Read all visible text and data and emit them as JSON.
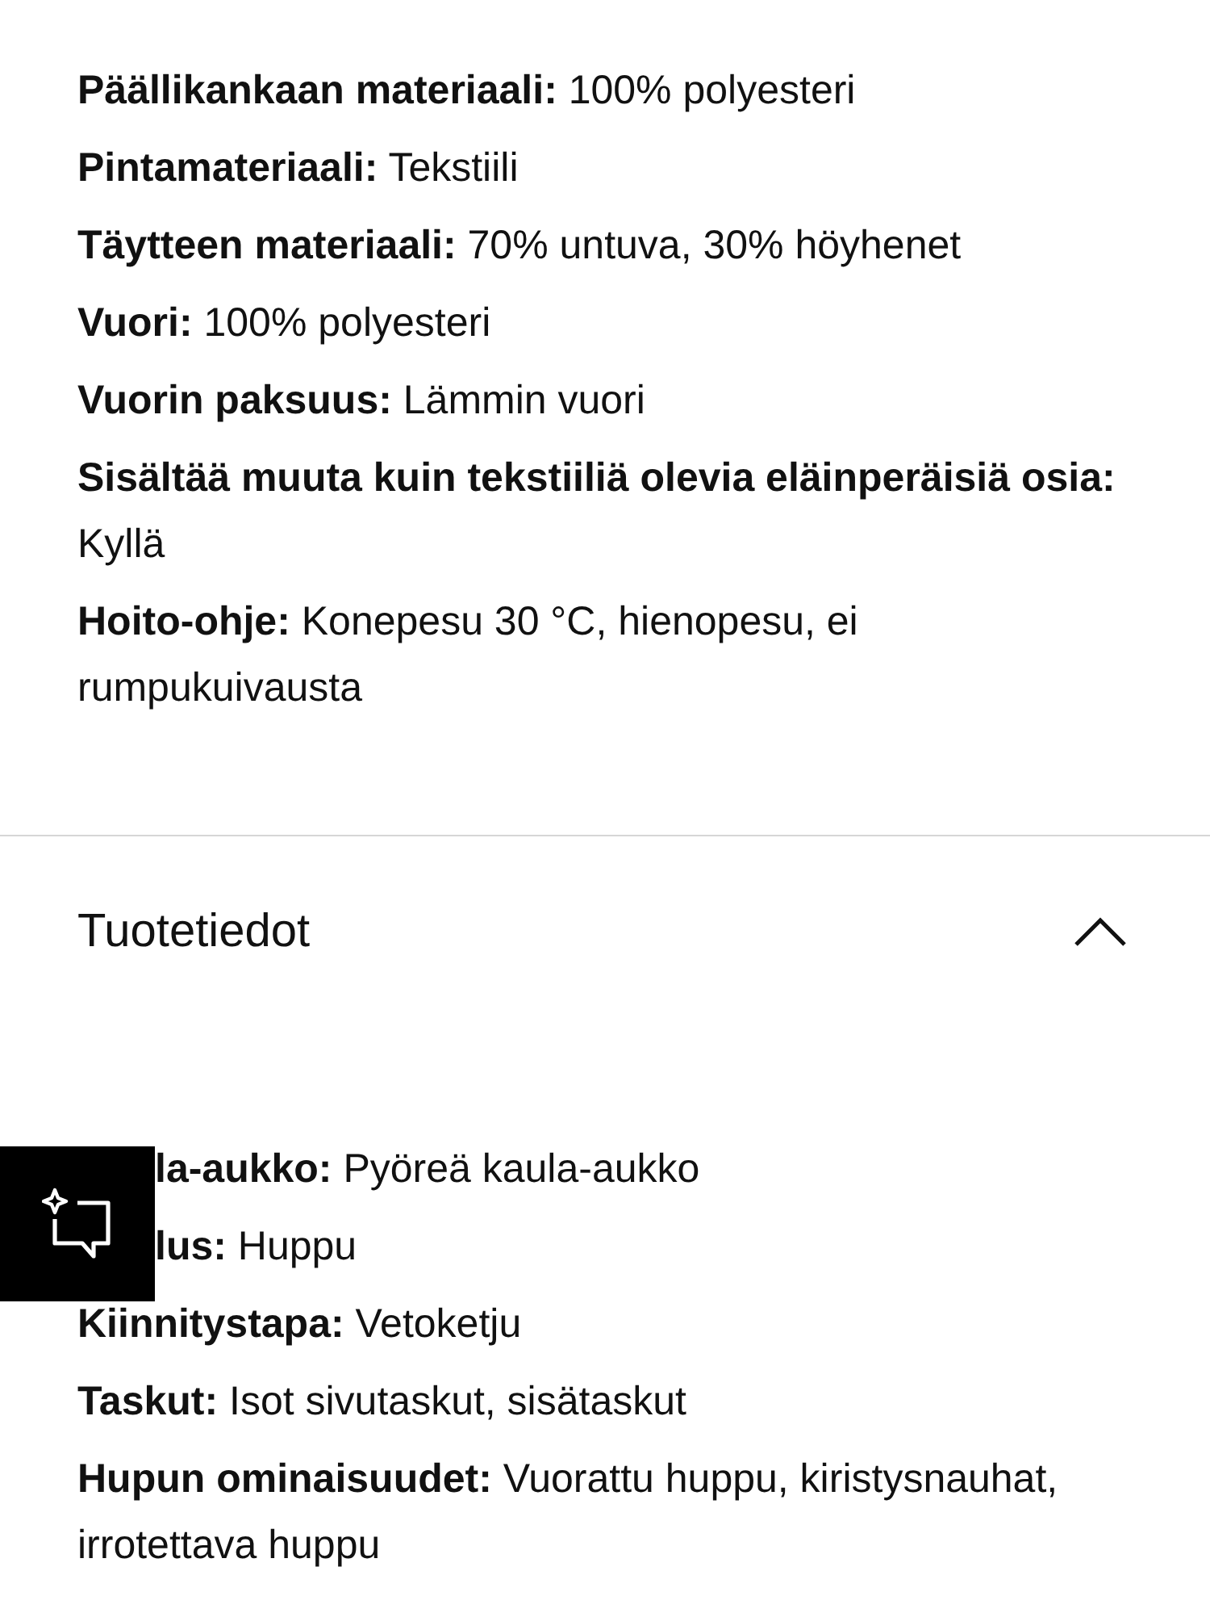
{
  "materials": [
    {
      "label": "Päällikankaan materiaali:",
      "value": "100% polyesteri"
    },
    {
      "label": "Pintamateriaali:",
      "value": "Tekstiili"
    },
    {
      "label": "Täytteen materiaali:",
      "value": "70% untuva, 30% höyhenet"
    },
    {
      "label": "Vuori:",
      "value": "100% polyesteri"
    },
    {
      "label": "Vuorin paksuus:",
      "value": "Lämmin vuori"
    },
    {
      "label": "Sisältää muuta kuin tekstiiliä olevia eläinperäisiä osia:",
      "value": "Kyllä"
    },
    {
      "label": "Hoito-ohje:",
      "value": "Konepesu 30 °C, hienopesu, ei rumpukuivausta"
    }
  ],
  "product_info": {
    "title": "Tuotetiedot",
    "expanded": true,
    "details": [
      {
        "label": "la-aukko:",
        "value": "Pyöreä kaula-aukko",
        "kind": "covered"
      },
      {
        "label": "lus:",
        "value": "Huppu",
        "kind": "covered"
      },
      {
        "label": "Kiinnitystapa:",
        "value": "Vetoketju",
        "kind": "plain"
      },
      {
        "label": "Taskut:",
        "value": "Isot sivutaskut, sisätaskut",
        "kind": "plain"
      },
      {
        "label": "Hupun ominaisuudet:",
        "value": "Vuorattu huppu, kiristysnauhat, irrotettava huppu",
        "kind": "plain"
      }
    ]
  }
}
